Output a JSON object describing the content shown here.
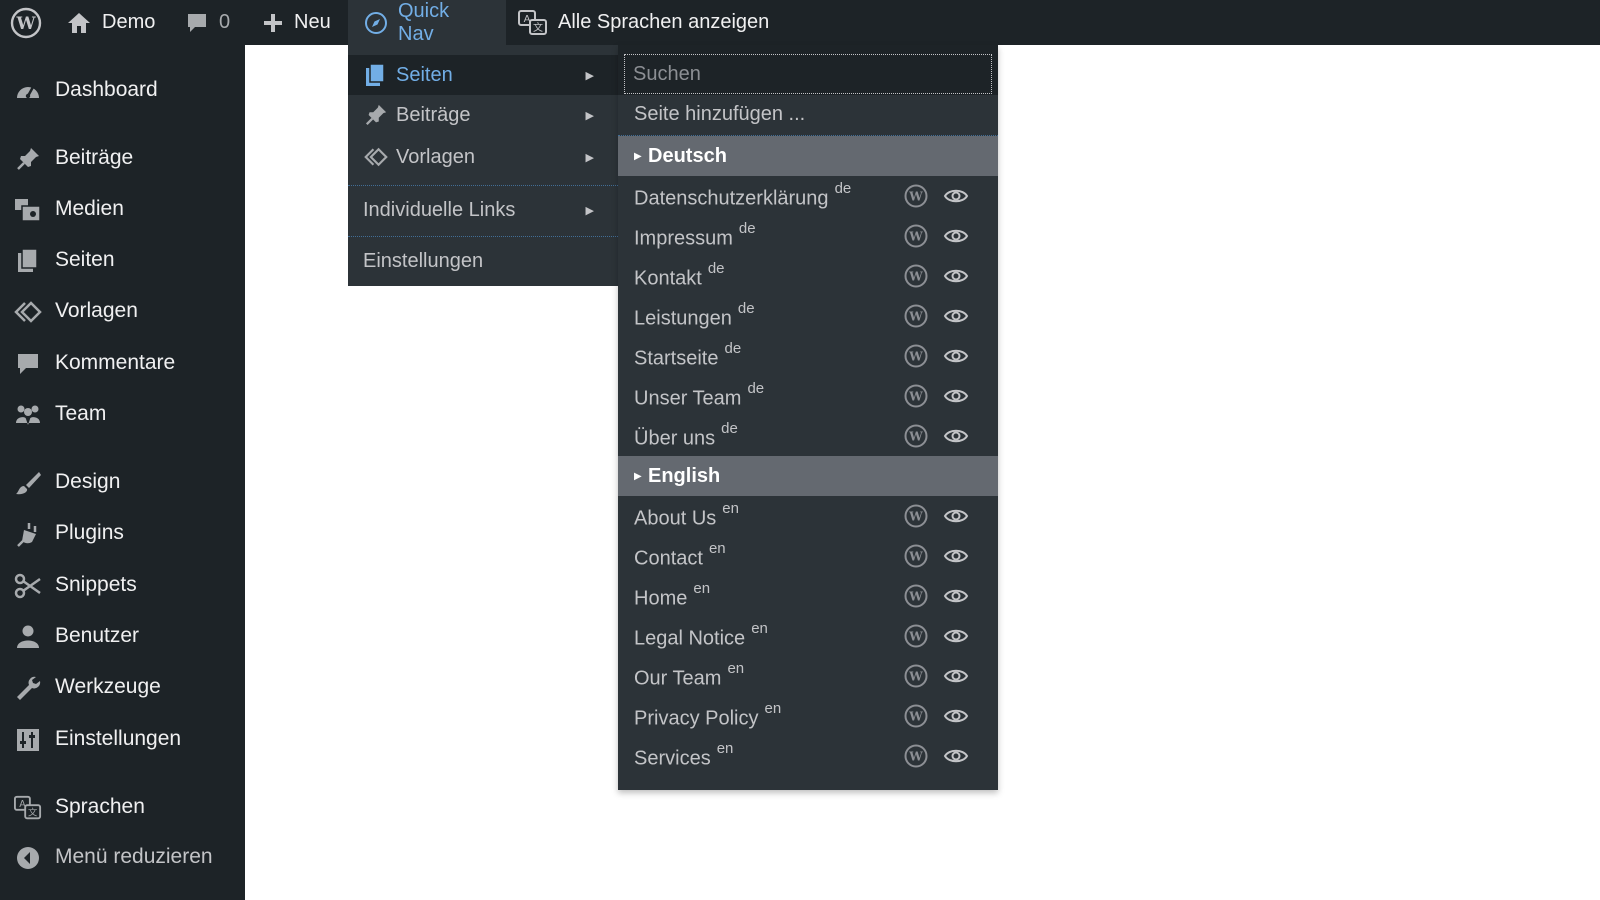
{
  "adminbar": {
    "site_name": "Demo",
    "comments_count": "0",
    "new_label": "Neu",
    "quicknav_label": "Quick Nav",
    "languages_label": "Alle Sprachen anzeigen"
  },
  "sidebar": {
    "items": [
      {
        "label": "Dashboard",
        "icon": "dashboard-icon"
      },
      {
        "label": "Beiträge",
        "icon": "pin-icon"
      },
      {
        "label": "Medien",
        "icon": "media-icon"
      },
      {
        "label": "Seiten",
        "icon": "pages-icon"
      },
      {
        "label": "Vorlagen",
        "icon": "template-icon"
      },
      {
        "label": "Kommentare",
        "icon": "comment-icon"
      },
      {
        "label": "Team",
        "icon": "group-icon"
      },
      {
        "label": "Design",
        "icon": "brush-icon"
      },
      {
        "label": "Plugins",
        "icon": "plugin-icon"
      },
      {
        "label": "Snippets",
        "icon": "scissors-icon"
      },
      {
        "label": "Benutzer",
        "icon": "user-icon"
      },
      {
        "label": "Werkzeuge",
        "icon": "wrench-icon"
      },
      {
        "label": "Einstellungen",
        "icon": "settings-icon"
      },
      {
        "label": "Sprachen",
        "icon": "translate-icon"
      }
    ],
    "collapse_label": "Menü reduzieren"
  },
  "quicknav": {
    "items": [
      {
        "label": "Seiten"
      },
      {
        "label": "Beiträge"
      },
      {
        "label": "Vorlagen"
      },
      {
        "label": "Individuelle Links"
      },
      {
        "label": "Einstellungen"
      }
    ]
  },
  "submenu": {
    "search_placeholder": "Suchen",
    "add_page_label": "Seite hinzufügen ...",
    "groups": [
      {
        "language": "Deutsch",
        "pages": [
          {
            "title": "Datenschutzerklärung",
            "lang": "de"
          },
          {
            "title": "Impressum",
            "lang": "de"
          },
          {
            "title": "Kontakt",
            "lang": "de"
          },
          {
            "title": "Leistungen",
            "lang": "de"
          },
          {
            "title": "Startseite",
            "lang": "de"
          },
          {
            "title": "Unser Team",
            "lang": "de"
          },
          {
            "title": "Über uns",
            "lang": "de"
          }
        ]
      },
      {
        "language": "English",
        "pages": [
          {
            "title": "About Us",
            "lang": "en"
          },
          {
            "title": "Contact",
            "lang": "en"
          },
          {
            "title": "Home",
            "lang": "en"
          },
          {
            "title": "Legal Notice",
            "lang": "en"
          },
          {
            "title": "Our Team",
            "lang": "en"
          },
          {
            "title": "Privacy Policy",
            "lang": "en"
          },
          {
            "title": "Services",
            "lang": "en"
          }
        ]
      }
    ]
  },
  "colors": {
    "bar_bg": "#1d2327",
    "menu_bg": "#2c3338",
    "accent": "#72aee6",
    "group_header_bg": "#646970"
  }
}
